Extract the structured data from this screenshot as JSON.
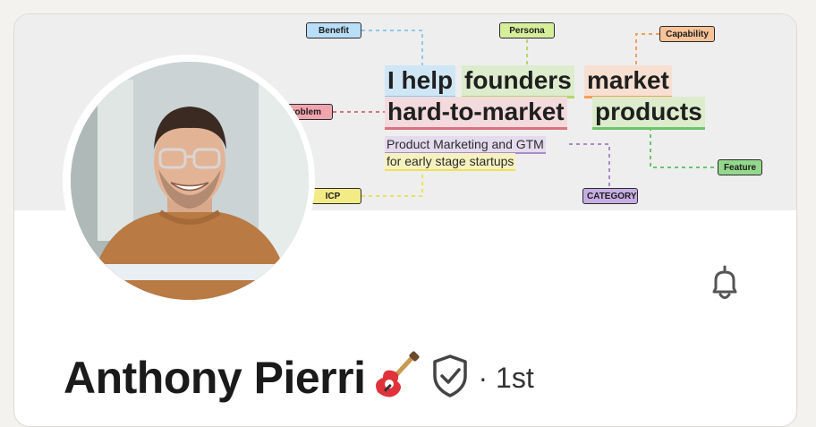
{
  "banner": {
    "headline": {
      "i_help": "I help",
      "founders": "founders",
      "market": "market",
      "hard_to_market": "hard-to-market",
      "products": "products"
    },
    "subline1": "Product Marketing and GTM",
    "subline2": "for early stage startups",
    "tags": {
      "benefit": "Benefit",
      "persona": "Persona",
      "capability": "Capability",
      "problem": "Problem",
      "feature": "Feature",
      "icp": "ICP",
      "category": "CATEGORY"
    }
  },
  "profile": {
    "name": "Anthony Pierri",
    "emoji": "🎸",
    "degree": "· 1st"
  },
  "icons": {
    "bell": "bell-icon",
    "shield": "verified-shield-icon",
    "guitar": "guitar-icon"
  },
  "colors": {
    "blue_hl": "#cfe6f5",
    "green_hl": "#dceccc",
    "peach_hl": "#f7e0d2",
    "pink_hl": "#f3dadd",
    "purple_hl": "#e4dbee",
    "yellow_hl": "#f6f2c0"
  }
}
